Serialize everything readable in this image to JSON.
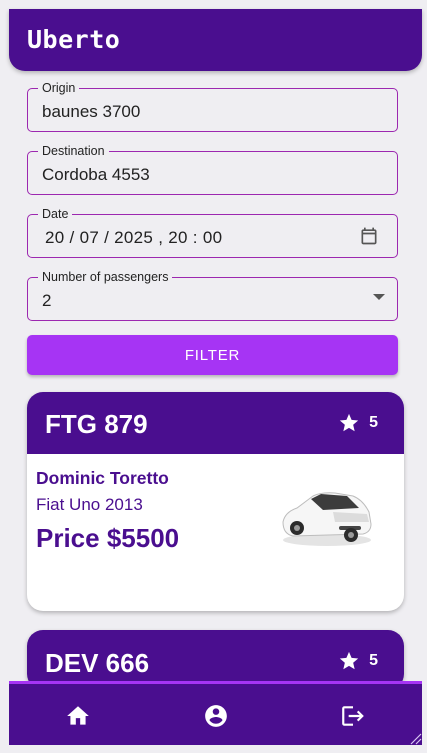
{
  "app": {
    "title": "Uberto"
  },
  "form": {
    "origin": {
      "label": "Origin",
      "value": "baunes 3700"
    },
    "destination": {
      "label": "Destination",
      "value": "Cordoba 4553"
    },
    "date": {
      "label": "Date",
      "value": "20 / 07 / 2025 ,  20 : 00"
    },
    "passengers": {
      "label": "Number of passengers",
      "value": "2"
    },
    "filter_label": "FILTER"
  },
  "trips": [
    {
      "plate": "FTG 879",
      "rating": "5",
      "driver": "Dominic Toretto",
      "car": "Fiat Uno 2013",
      "price": "Price $5500"
    },
    {
      "plate": "DEV 666",
      "rating": "5"
    }
  ],
  "nav": {
    "items": [
      "home-icon",
      "account-icon",
      "logout-icon"
    ]
  },
  "colors": {
    "primary": "#4a0e8f",
    "accent": "#a634f4",
    "field_border": "#9c27b0"
  }
}
